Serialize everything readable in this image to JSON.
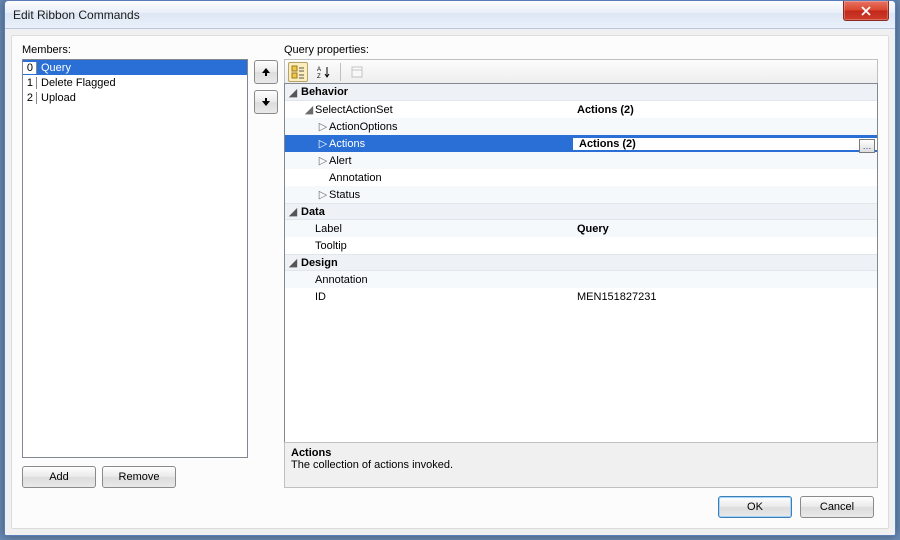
{
  "window": {
    "title": "Edit Ribbon Commands"
  },
  "labels": {
    "members": "Members:",
    "query_props": "Query properties:",
    "add": "Add",
    "remove": "Remove",
    "ok": "OK",
    "cancel": "Cancel"
  },
  "members": [
    {
      "index": "0",
      "name": "Query",
      "selected": true
    },
    {
      "index": "1",
      "name": "Delete Flagged",
      "selected": false
    },
    {
      "index": "2",
      "name": "Upload",
      "selected": false
    }
  ],
  "grid": {
    "sections": [
      {
        "title": "Behavior",
        "rows": [
          {
            "indent": 1,
            "expander": "open",
            "name": "SelectActionSet",
            "value": "Actions (2)",
            "bold": true,
            "alt": false
          },
          {
            "indent": 2,
            "expander": "closed",
            "name": "ActionOptions",
            "value": "",
            "alt": true
          },
          {
            "indent": 2,
            "expander": "closed",
            "name": "Actions",
            "value": "Actions (2)",
            "bold": true,
            "selected": true,
            "edit": true
          },
          {
            "indent": 2,
            "expander": "closed",
            "name": "Alert",
            "value": "",
            "alt": true
          },
          {
            "indent": 2,
            "expander": "none",
            "name": "Annotation",
            "value": ""
          },
          {
            "indent": 2,
            "expander": "closed",
            "name": "Status",
            "value": "",
            "alt": true
          }
        ]
      },
      {
        "title": "Data",
        "rows": [
          {
            "indent": 1,
            "expander": "none",
            "name": "Label",
            "value": "Query",
            "bold": true,
            "alt": true
          },
          {
            "indent": 1,
            "expander": "none",
            "name": "Tooltip",
            "value": ""
          }
        ]
      },
      {
        "title": "Design",
        "rows": [
          {
            "indent": 1,
            "expander": "none",
            "name": "Annotation",
            "value": "",
            "alt": true
          },
          {
            "indent": 1,
            "expander": "none",
            "name": "ID",
            "value": "MEN151827231",
            "disabled": true
          }
        ]
      }
    ]
  },
  "description": {
    "title": "Actions",
    "text": "The collection of actions invoked."
  }
}
